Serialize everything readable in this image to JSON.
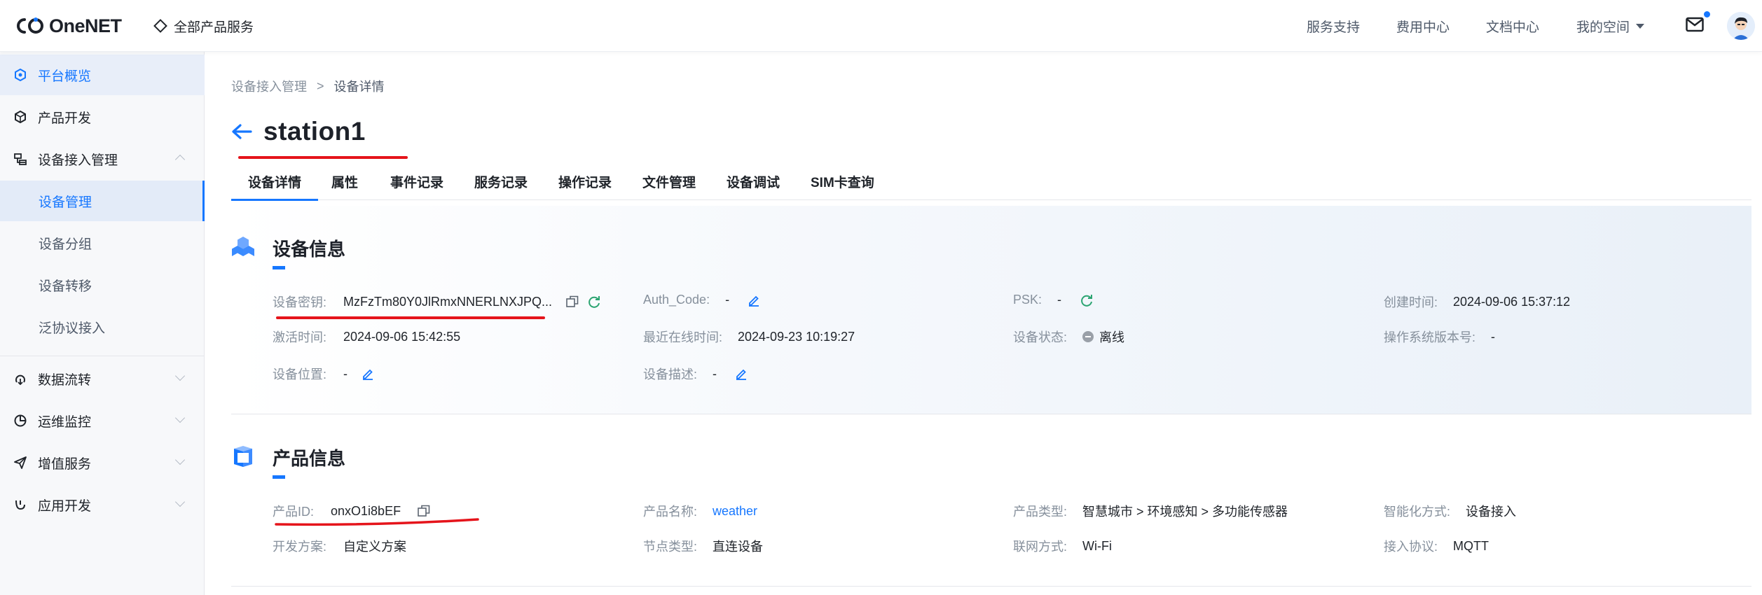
{
  "header": {
    "logo_text": "OneNET",
    "all_products": "全部产品服务",
    "nav": [
      "服务支持",
      "费用中心",
      "文档中心"
    ],
    "my_space": "我的空间"
  },
  "sidebar": {
    "items": [
      {
        "label": "平台概览"
      },
      {
        "label": "产品开发"
      },
      {
        "label": "设备接入管理"
      },
      {
        "label": "设备管理"
      },
      {
        "label": "设备分组"
      },
      {
        "label": "设备转移"
      },
      {
        "label": "泛协议接入"
      },
      {
        "label": "数据流转"
      },
      {
        "label": "运维监控"
      },
      {
        "label": "增值服务"
      },
      {
        "label": "应用开发"
      }
    ]
  },
  "breadcrumb": {
    "parent": "设备接入管理",
    "separator": ">",
    "current": "设备详情"
  },
  "page": {
    "title": "station1"
  },
  "tabs": [
    "设备详情",
    "属性",
    "事件记录",
    "服务记录",
    "操作记录",
    "文件管理",
    "设备调试",
    "SIM卡查询"
  ],
  "device_info": {
    "title": "设备信息",
    "fields": [
      {
        "label": "设备密钥:",
        "value": "MzFzTm80Y0JlRmxNNERLNXJPQ..."
      },
      {
        "label": "Auth_Code:",
        "value": "-"
      },
      {
        "label": "PSK:",
        "value": "-"
      },
      {
        "label": "创建时间:",
        "value": "2024-09-06 15:37:12"
      },
      {
        "label": "激活时间:",
        "value": "2024-09-06 15:42:55"
      },
      {
        "label": "最近在线时间:",
        "value": "2024-09-23 10:19:27"
      },
      {
        "label": "设备状态:",
        "value": "离线"
      },
      {
        "label": "操作系统版本号:",
        "value": "-"
      },
      {
        "label": "设备位置:",
        "value": "-"
      },
      {
        "label": "设备描述:",
        "value": "-"
      }
    ]
  },
  "product_info": {
    "title": "产品信息",
    "fields": [
      {
        "label": "产品ID:",
        "value": "onxO1i8bEF"
      },
      {
        "label": "产品名称:",
        "value": "weather"
      },
      {
        "label": "产品类型:",
        "value": "智慧城市 > 环境感知 > 多功能传感器"
      },
      {
        "label": "智能化方式:",
        "value": "设备接入"
      },
      {
        "label": "开发方案:",
        "value": "自定义方案"
      },
      {
        "label": "节点类型:",
        "value": "直连设备"
      },
      {
        "label": "联网方式:",
        "value": "Wi-Fi"
      },
      {
        "label": "接入协议:",
        "value": "MQTT"
      }
    ]
  },
  "colors": {
    "accent": "#1677ff",
    "annotation_red": "#e5141b",
    "refresh_green": "#2ba471"
  }
}
